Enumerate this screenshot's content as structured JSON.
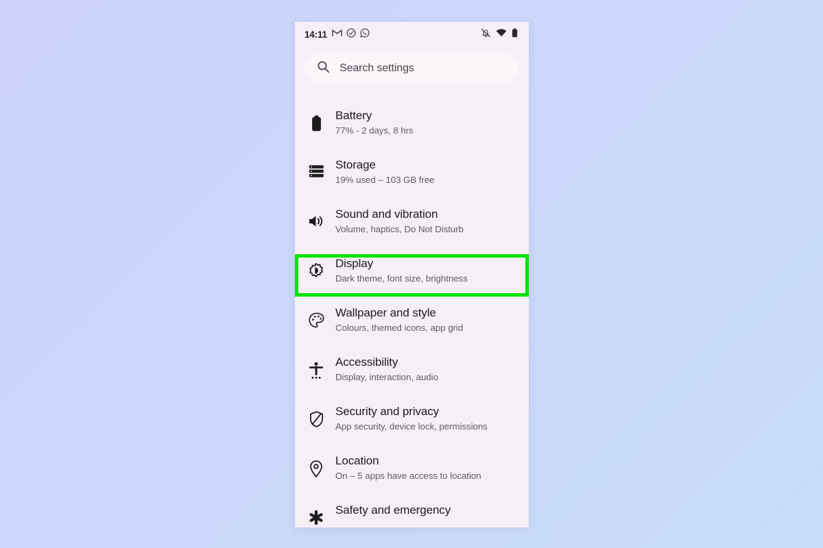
{
  "colors": {
    "page_background_start": "#ccd2fb",
    "page_background_end": "#c7dcf8",
    "phone_background": "#f6eff5",
    "search_background": "#faf6fa",
    "title_text": "#1c1b1e",
    "subtitle_text": "#5d5c60",
    "highlight_green": "#00e400"
  },
  "status_bar": {
    "time": "14:11",
    "left_icons": [
      {
        "name": "gmail-icon",
        "label": "M"
      },
      {
        "name": "check-circle-icon",
        "label": ""
      },
      {
        "name": "whatsapp-icon",
        "label": ""
      }
    ],
    "right_icons": [
      {
        "name": "notifications-muted-icon",
        "label": ""
      },
      {
        "name": "wifi-icon",
        "label": ""
      },
      {
        "name": "battery-full-icon",
        "label": ""
      }
    ]
  },
  "search": {
    "icon": "search-icon",
    "placeholder": "Search settings",
    "value": ""
  },
  "settings": {
    "items": [
      {
        "icon": "battery-icon",
        "title": "Battery",
        "subtitle": "77% - 2 days, 8 hrs",
        "highlighted": false
      },
      {
        "icon": "storage-icon",
        "title": "Storage",
        "subtitle": "19% used – 103 GB free",
        "highlighted": false
      },
      {
        "icon": "sound-icon",
        "title": "Sound and vibration",
        "subtitle": "Volume, haptics, Do Not Disturb",
        "highlighted": false
      },
      {
        "icon": "display-brightness-icon",
        "title": "Display",
        "subtitle": "Dark theme, font size, brightness",
        "highlighted": true
      },
      {
        "icon": "palette-icon",
        "title": "Wallpaper and style",
        "subtitle": "Colours, themed icons, app grid",
        "highlighted": false
      },
      {
        "icon": "accessibility-icon",
        "title": "Accessibility",
        "subtitle": "Display, interaction, audio",
        "highlighted": false
      },
      {
        "icon": "shield-icon",
        "title": "Security and privacy",
        "subtitle": "App security, device lock, permissions",
        "highlighted": false
      },
      {
        "icon": "location-pin-icon",
        "title": "Location",
        "subtitle": "On – 5 apps have access to location",
        "highlighted": false
      },
      {
        "icon": "emergency-star-icon",
        "title": "Safety and emergency",
        "subtitle": "",
        "highlighted": false
      }
    ]
  }
}
